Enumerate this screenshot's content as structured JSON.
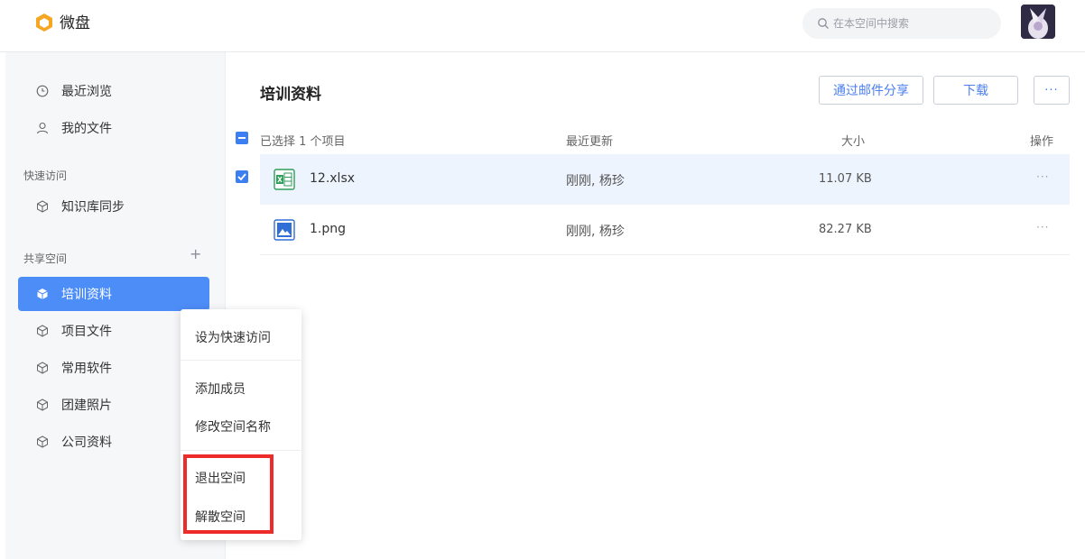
{
  "header": {
    "app_title": "微盘",
    "search_placeholder": "在本空间中搜索",
    "logo_color": "#f5a623"
  },
  "sidebar": {
    "items": [
      {
        "label": "最近浏览",
        "icon": "clock-icon"
      },
      {
        "label": "我的文件",
        "icon": "user-icon"
      }
    ],
    "quick_access": {
      "label": "快速访问",
      "items": [
        {
          "label": "知识库同步",
          "icon": "cube-icon"
        }
      ]
    },
    "shared": {
      "label": "共享空间",
      "add_icon": "plus-icon",
      "items": [
        {
          "label": "培训资料",
          "icon": "cube-icon",
          "active": true
        },
        {
          "label": "项目文件",
          "icon": "cube-icon"
        },
        {
          "label": "常用软件",
          "icon": "cube-icon"
        },
        {
          "label": "团建照片",
          "icon": "cube-icon"
        },
        {
          "label": "公司资料",
          "icon": "cube-icon"
        }
      ]
    },
    "active_color": "#4d8df7"
  },
  "main": {
    "title": "培训资料",
    "buttons": {
      "share": "通过邮件分享",
      "download": "下载",
      "more": "···"
    },
    "columns": {
      "selection": "已选择 1 个项目",
      "updated": "最近更新",
      "size": "大小",
      "ops": "操作"
    },
    "files": [
      {
        "name": "12.xlsx",
        "type": "excel-icon",
        "updated": "刚刚, 杨珍",
        "size": "11.07 KB",
        "ops": "···",
        "selected": true
      },
      {
        "name": "1.png",
        "type": "image-icon",
        "updated": "刚刚, 杨珍",
        "size": "82.27 KB",
        "ops": "···",
        "selected": false
      }
    ]
  },
  "context_menu": {
    "items": [
      "设为快速访问",
      "添加成员",
      "修改空间名称",
      "退出空间",
      "解散空间"
    ],
    "highlight_color": "#ee2b2b"
  }
}
